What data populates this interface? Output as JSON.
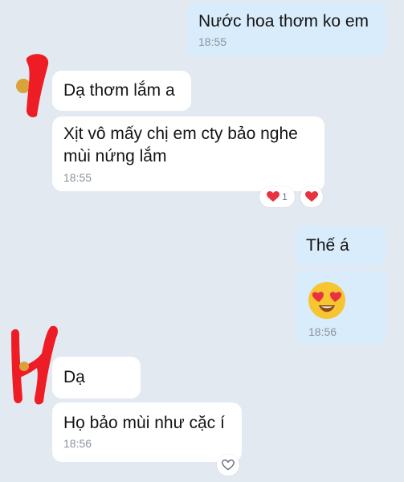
{
  "messages": [
    {
      "id": "m1",
      "side": "out",
      "text": "Nước hoa thơm ko em",
      "time": "18:55"
    },
    {
      "id": "m2",
      "side": "in",
      "text": "Dạ thơm lắm a"
    },
    {
      "id": "m3",
      "side": "in",
      "text": "Xịt vô mấy chị em cty bảo nghe\nmùi nứng lắm",
      "time": "18:55"
    },
    {
      "id": "m4",
      "side": "out",
      "text": "Thế á"
    },
    {
      "id": "m5",
      "side": "out",
      "emoji": "heart-eyes-emoji",
      "time": "18:56"
    },
    {
      "id": "m6",
      "side": "in",
      "text": "Dạ"
    },
    {
      "id": "m7",
      "side": "in",
      "text": "Họ bảo mùi như cặc í",
      "time": "18:56"
    }
  ],
  "reactions": {
    "m3": {
      "count": "1",
      "icon": "heart-icon"
    },
    "m7": {
      "icon": "heart-outline-icon"
    }
  },
  "colors": {
    "background": "#e3e9f1",
    "incoming_bubble": "#ffffff",
    "outgoing_bubble": "#d9ecfb",
    "timestamp": "#8b939d",
    "heart": "#e8323f",
    "redaction": "#ee1c24"
  }
}
